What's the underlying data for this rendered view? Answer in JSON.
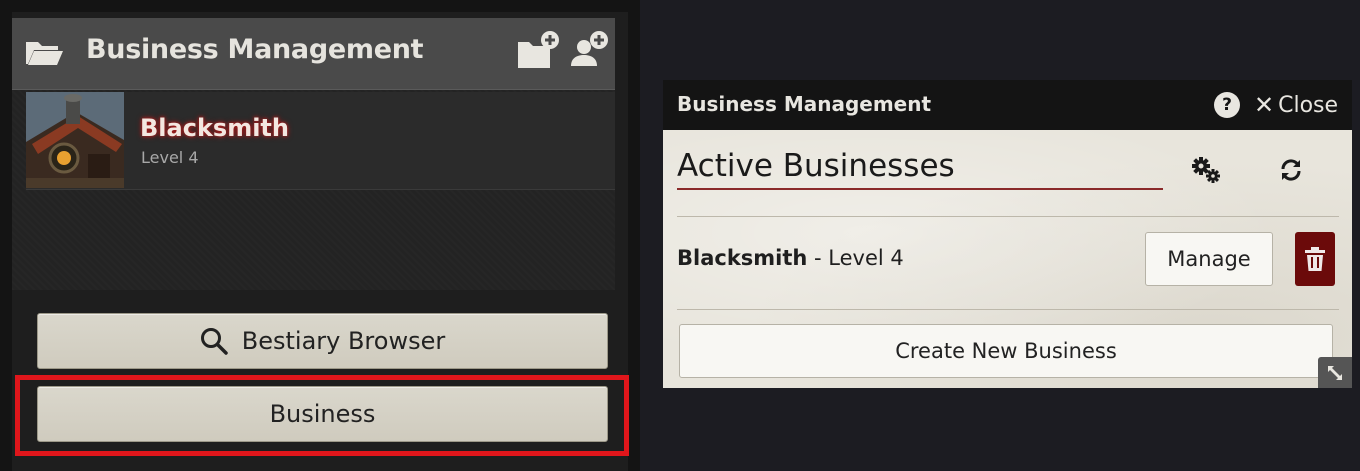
{
  "sidebar": {
    "header_title": "Business Management",
    "icons": {
      "folder": "open-folder-icon",
      "create_folder": "create-folder-icon",
      "create_actor": "add-user-icon"
    },
    "items": [
      {
        "name": "Blacksmith",
        "subtitle": "Level 4",
        "thumbnail": "blacksmith-thumbnail"
      }
    ],
    "buttons": {
      "bestiary": "Bestiary Browser",
      "business": "Business"
    },
    "highlight_color": "#e0161b"
  },
  "window": {
    "title": "Business Management",
    "help_label": "?",
    "close_label": "Close",
    "section_title": "Active Businesses",
    "businesses": [
      {
        "name": "Blacksmith",
        "level_text": " - Level 4"
      }
    ],
    "manage_label": "Manage",
    "create_label": "Create New Business",
    "colors": {
      "delete_bg": "#6b0a0a",
      "rule": "#8a2a2a"
    }
  }
}
